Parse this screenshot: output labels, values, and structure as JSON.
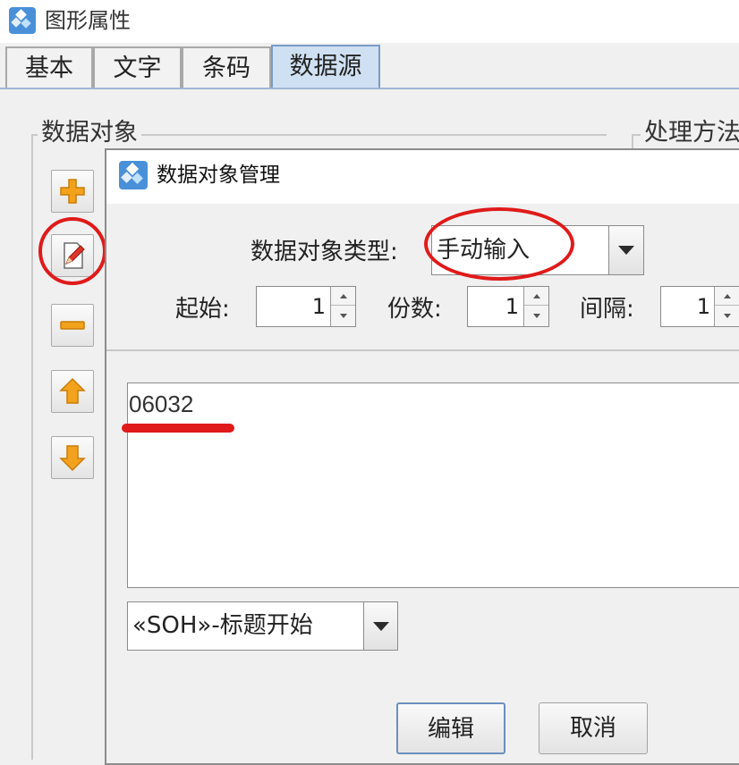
{
  "window": {
    "title": "图形属性"
  },
  "tabs": [
    {
      "label": "基本"
    },
    {
      "label": "文字"
    },
    {
      "label": "条码"
    },
    {
      "label": "数据源"
    }
  ],
  "active_tab": "数据源",
  "groups": {
    "data_object_label": "数据对象",
    "processing_label": "处理方法"
  },
  "side_buttons": [
    {
      "icon": "plus-icon"
    },
    {
      "icon": "edit-icon"
    },
    {
      "icon": "minus-icon"
    },
    {
      "icon": "arrow-up-icon"
    },
    {
      "icon": "arrow-down-icon"
    }
  ],
  "dialog": {
    "title": "数据对象管理",
    "type_label": "数据对象类型:",
    "type_value": "手动输入",
    "start_label": "起始:",
    "start_value": "1",
    "copies_label": "份数:",
    "copies_value": "1",
    "interval_label": "间隔:",
    "interval_value": "1",
    "content": "06032",
    "special_char_value": "«SOH»-标题开始",
    "edit_button": "编辑",
    "cancel_button": "取消"
  },
  "colors": {
    "annotation_red": "#e01a1a",
    "active_tab": "#cfe0f2",
    "icon_orange": "#f2a21c"
  }
}
